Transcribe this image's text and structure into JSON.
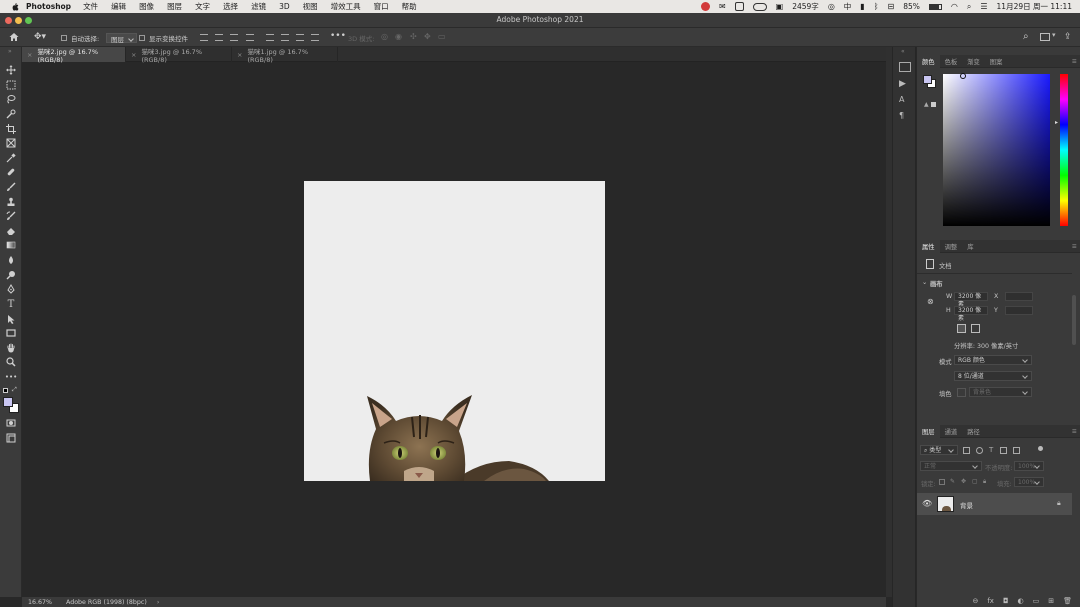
{
  "menubar": {
    "app": "Photoshop",
    "items": [
      "文件",
      "编辑",
      "图像",
      "图层",
      "文字",
      "选择",
      "滤镜",
      "3D",
      "视图",
      "增效工具",
      "窗口",
      "帮助"
    ],
    "word_count": "2459字",
    "input_method": "中",
    "battery": "85%",
    "datetime": "11月29日 周一  11:11"
  },
  "window": {
    "title": "Adobe Photoshop 2021"
  },
  "options": {
    "auto_select_label": "自动选择:",
    "auto_select_target": "图层",
    "show_transform_label": "显示变换控件",
    "mode_3d_label": "3D 模式:"
  },
  "tabs": [
    {
      "label": "猫咪2.jpg @ 16.7%(RGB/8)",
      "active": true
    },
    {
      "label": "猫咪3.jpg @ 16.7%(RGB/8)",
      "active": false
    },
    {
      "label": "猫咪1.jpg @ 16.7%(RGB/8)",
      "active": false
    }
  ],
  "status": {
    "zoom": "16.67%",
    "profile": "Adobe RGB (1998) (8bpc)"
  },
  "color_panel": {
    "tabs": [
      "颜色",
      "色板",
      "渐变",
      "图案"
    ],
    "foreground": "#c9c6f2",
    "hue_color": "#1a1aff"
  },
  "properties_panel": {
    "tabs": [
      "属性",
      "调整",
      "库"
    ],
    "doc_label": "文档",
    "section": "画布",
    "width_label": "W",
    "width_value": "3200 像素",
    "height_label": "H",
    "height_value": "3200 像素",
    "x_label": "X",
    "y_label": "Y",
    "resolution": "分辨率: 300 像素/英寸",
    "mode_label": "模式",
    "mode_value": "RGB 颜色",
    "depth_value": "8 位/通道",
    "fill_label": "填色",
    "fill_value": "背景色"
  },
  "layers_panel": {
    "tabs": [
      "图层",
      "通道",
      "路径"
    ],
    "filter_label": "类型",
    "blend_mode": "正常",
    "opacity_label": "不透明度:",
    "opacity_value": "100%",
    "lock_label": "锁定:",
    "fill_label": "填充:",
    "fill_value": "100%",
    "layers": [
      {
        "name": "背景",
        "visible": true,
        "locked": true
      }
    ]
  }
}
